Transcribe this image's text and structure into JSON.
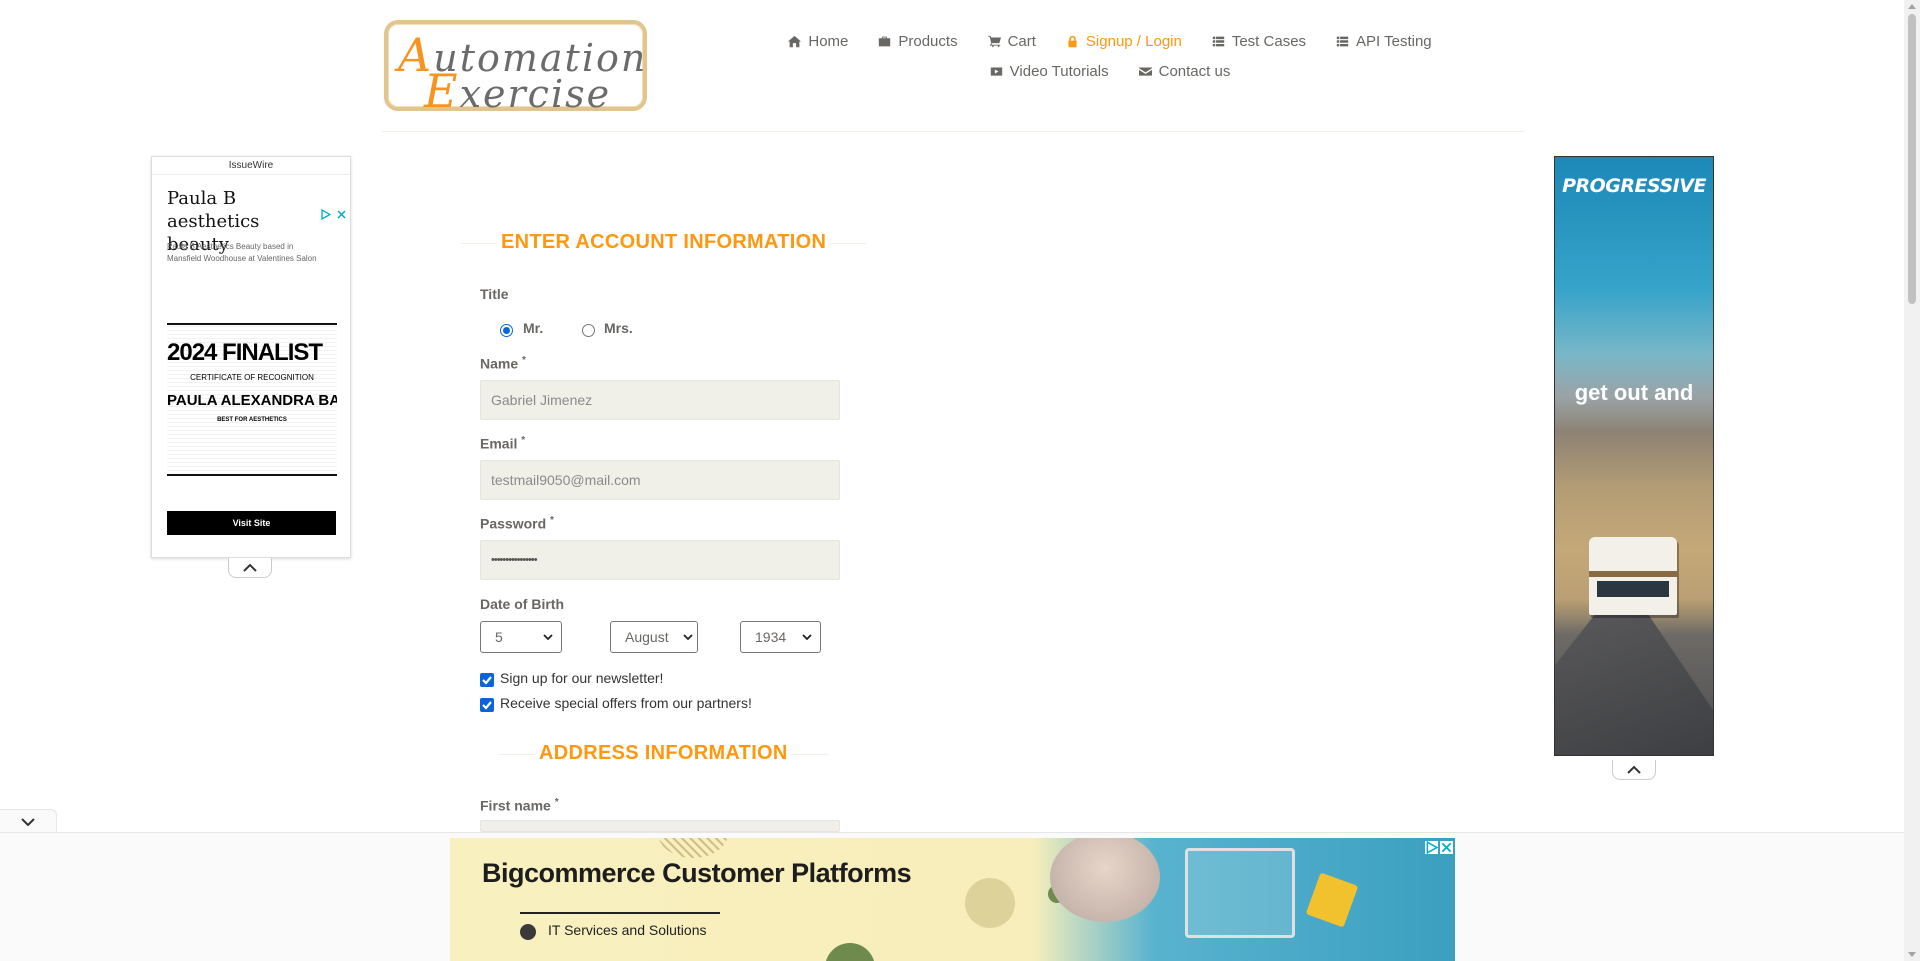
{
  "logo": {
    "line1_cap": "A",
    "line1_rest": "utomation",
    "line2_cap": "E",
    "line2_rest": "xercise"
  },
  "nav": {
    "items": [
      {
        "label": "Home",
        "icon": "home-icon"
      },
      {
        "label": "Products",
        "icon": "briefcase-icon"
      },
      {
        "label": "Cart",
        "icon": "cart-icon"
      },
      {
        "label": "Signup / Login",
        "icon": "lock-icon",
        "active": true
      },
      {
        "label": "Test Cases",
        "icon": "list-icon"
      },
      {
        "label": "API Testing",
        "icon": "list-icon"
      },
      {
        "label": "Video Tutorials",
        "icon": "youtube-play-icon"
      },
      {
        "label": "Contact us",
        "icon": "envelope-icon"
      }
    ],
    "active_color": "#fe980f"
  },
  "ad_left": {
    "source": "IssueWire",
    "headline": "Paula B aesthetics beauty",
    "subtext": "Paula B Aesthetics Beauty based in Mansfield Woodhouse at Valentines Salon",
    "cert_big": "2024 FINALIST",
    "cert_line": "CERTIFICATE OF RECOGNITION",
    "cert_name": "PAULA ALEXANDRA BACIU",
    "cert_best": "BEST FOR AESTHETICS",
    "button": "Visit Site"
  },
  "ad_right": {
    "brand": "PROGRESSIVE",
    "tagline": "get out and"
  },
  "form": {
    "account_title": "ENTER ACCOUNT INFORMATION",
    "title_label": "Title",
    "title_options": [
      "Mr.",
      "Mrs."
    ],
    "title_selected": "Mr.",
    "name_label": "Name",
    "name_value": "Gabriel Jimenez",
    "email_label": "Email",
    "email_value": "testmail9050@mail.com",
    "password_label": "Password",
    "password_value": "••••••••••••••••",
    "dob_label": "Date of Birth",
    "dob_day": "5",
    "dob_month": "August",
    "dob_year": "1934",
    "newsletter_label": "Sign up for our newsletter!",
    "offers_label": "Receive special offers from our partners!",
    "address_title": "ADDRESS INFORMATION",
    "first_name_label": "First name",
    "required_mark": "*"
  },
  "ad_bottom": {
    "title": "Bigcommerce Customer Platforms",
    "subtitle": "IT Services and Solutions"
  }
}
